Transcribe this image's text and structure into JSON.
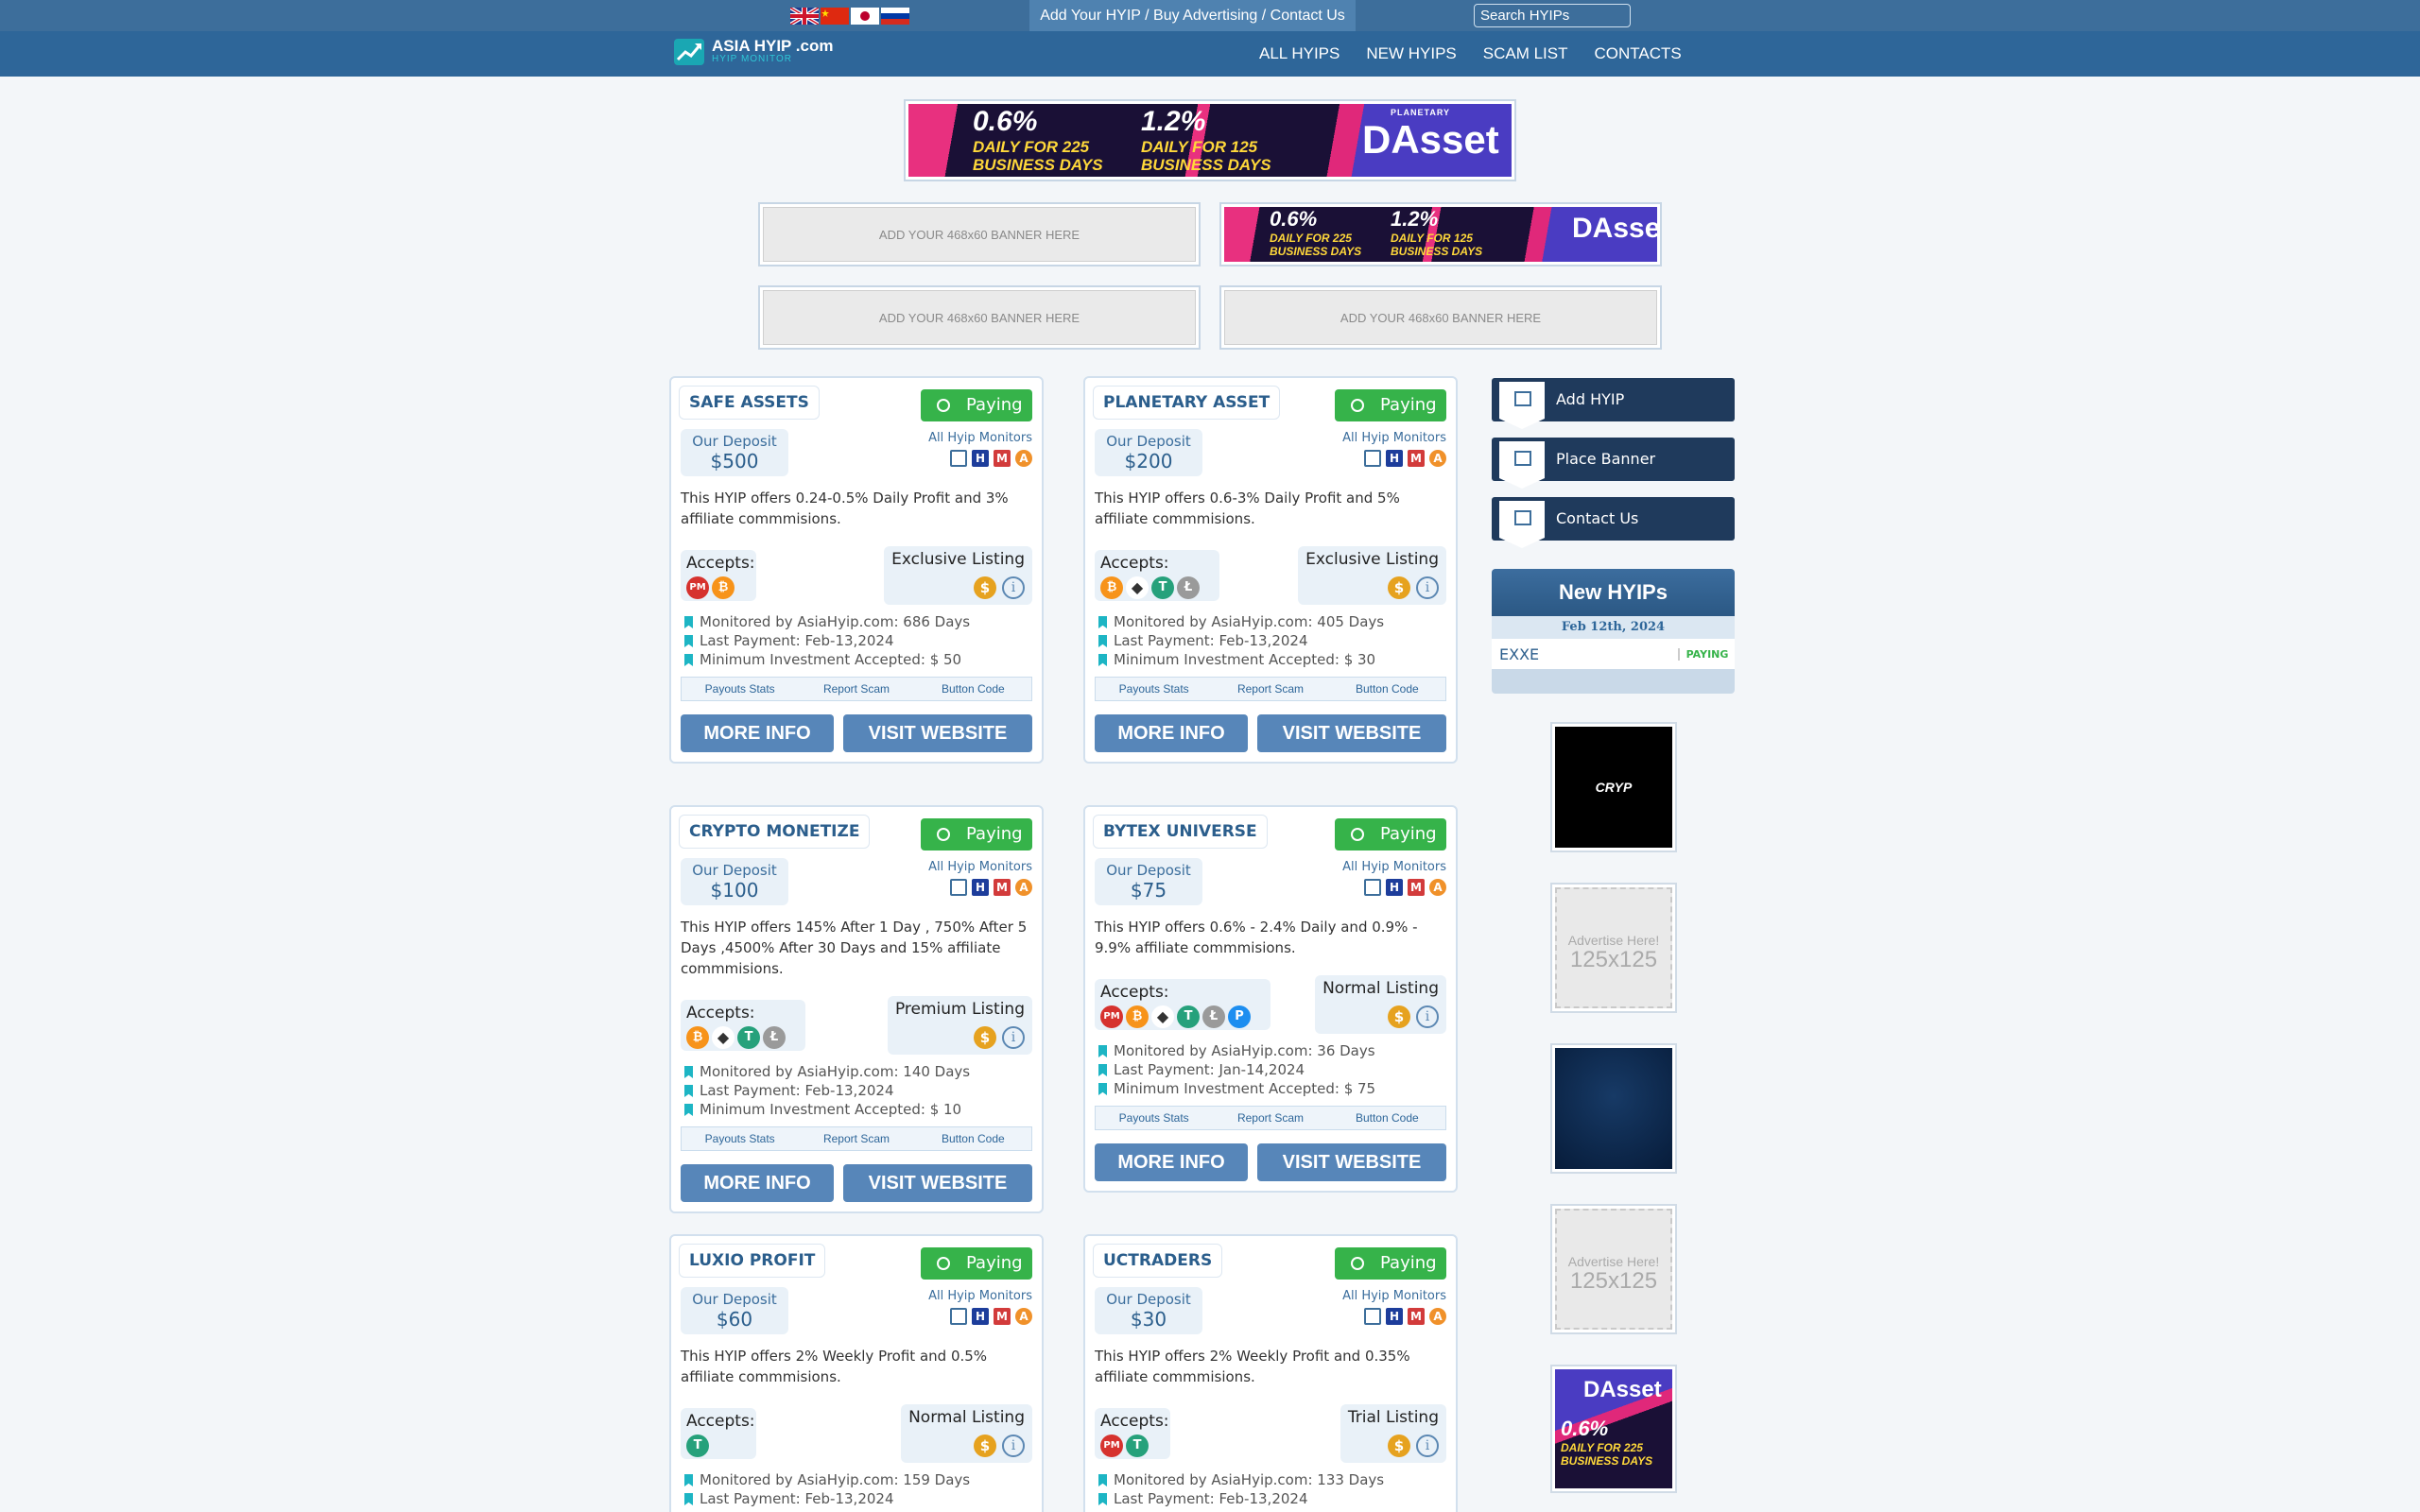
{
  "topbar": {
    "flags": [
      "uk-flag",
      "cn-flag",
      "jp-flag",
      "ru-flag"
    ],
    "links": [
      "Add Your HYIP",
      "Buy Advertising",
      "Contact Us"
    ],
    "separator": " / ",
    "search_placeholder": "Search HYIPs"
  },
  "logo": {
    "title": "ASIA HYIP .com",
    "subtitle": "HYIP MONITOR"
  },
  "nav": [
    "ALL HYIPS",
    "NEW HYIPS",
    "SCAM LIST",
    "CONTACTS"
  ],
  "banners": {
    "dasset": {
      "rate1": "0.6%",
      "line1a": "DAILY FOR 225",
      "line1b": "BUSINESS DAYS",
      "rate2": "1.2%",
      "line2a": "DAILY FOR 125",
      "line2b": "BUSINESS DAYS",
      "brand": "DAsset",
      "brand_top": "PLANETARY"
    },
    "slot_text": "ADD YOUR 468x60 BANNER HERE"
  },
  "common": {
    "status": "Paying",
    "deposit_label": "Our Deposit",
    "monitors_label": "All Hyip Monitors",
    "accepts_label": "Accepts:",
    "links": [
      "Payouts Stats",
      "Report Scam",
      "Button Code"
    ],
    "more_info": "MORE INFO",
    "visit": "VISIT WEBSITE"
  },
  "hyips": [
    {
      "name": "SAFE ASSETS",
      "deposit": "$500",
      "desc": "This HYIP offers 0.24-0.5% Daily Profit and 3% affiliate commmisions.",
      "listing": "Exclusive Listing",
      "coins": [
        "PM",
        "B"
      ],
      "monitored": "Monitored by AsiaHyip.com: 686 Days",
      "last_payment": "Last Payment: Feb-13,2024",
      "min_invest": "Minimum Investment Accepted: $ 50"
    },
    {
      "name": "PLANETARY ASSET",
      "deposit": "$200",
      "desc": "This HYIP offers 0.6-3% Daily Profit and 5% affiliate commmisions.",
      "listing": "Exclusive Listing",
      "coins": [
        "B",
        "E",
        "T",
        "L"
      ],
      "monitored": "Monitored by AsiaHyip.com: 405 Days",
      "last_payment": "Last Payment: Feb-13,2024",
      "min_invest": "Minimum Investment Accepted: $ 30"
    },
    {
      "name": "CRYPTO MONETIZE",
      "deposit": "$100",
      "desc": "This HYIP offers 145% After 1 Day , 750% After 5 Days ,4500% After 30 Days and 15% affiliate commmisions.",
      "listing": "Premium Listing",
      "coins": [
        "B",
        "E",
        "T",
        "L"
      ],
      "monitored": "Monitored by AsiaHyip.com: 140 Days",
      "last_payment": "Last Payment: Feb-13,2024",
      "min_invest": "Minimum Investment Accepted: $ 10"
    },
    {
      "name": "BYTEX UNIVERSE",
      "deposit": "$75",
      "desc": "This HYIP offers 0.6% - 2.4% Daily and 0.9% - 9.9% affiliate commmisions.",
      "listing": "Normal Listing",
      "coins": [
        "PM",
        "B",
        "E",
        "T",
        "L",
        "P"
      ],
      "monitored": "Monitored by AsiaHyip.com: 36 Days",
      "last_payment": "Last Payment: Jan-14,2024",
      "min_invest": "Minimum Investment Accepted: $ 75"
    },
    {
      "name": "LUXIO PROFIT",
      "deposit": "$60",
      "desc": "This HYIP offers 2% Weekly Profit and 0.5% affiliate commmisions.",
      "listing": "Normal Listing",
      "coins": [
        "T"
      ],
      "monitored": "Monitored by AsiaHyip.com: 159 Days",
      "last_payment": "Last Payment: Feb-13,2024",
      "min_invest": ""
    },
    {
      "name": "UCTRADERS",
      "deposit": "$30",
      "desc": "This HYIP offers 2% Weekly Profit and 0.35% affiliate commmisions.",
      "listing": "Trial Listing",
      "coins": [
        "PM",
        "T"
      ],
      "monitored": "Monitored by AsiaHyip.com: 133 Days",
      "last_payment": "Last Payment: Feb-13,2024",
      "min_invest": ""
    }
  ],
  "sidebar": {
    "buttons": [
      "Add HYIP",
      "Place Banner",
      "Contact Us"
    ],
    "new_hyips": {
      "title": "New HYIPs",
      "date": "Feb 12th, 2024",
      "items": [
        {
          "name": "EXXE",
          "status": "PAYING"
        }
      ]
    },
    "ads": {
      "cryp": "CRYP",
      "advertise_line1": "Advertise Here!",
      "advertise_line2": "125x125"
    }
  },
  "colors": {
    "paying": "#36b34a",
    "nav": "#2e6699",
    "button": "#5786b9",
    "btc": "#f7931a",
    "pm": "#d6322e",
    "tether": "#26a17b",
    "ltc": "#9a9a9a",
    "payeer": "#1d8ef0"
  }
}
